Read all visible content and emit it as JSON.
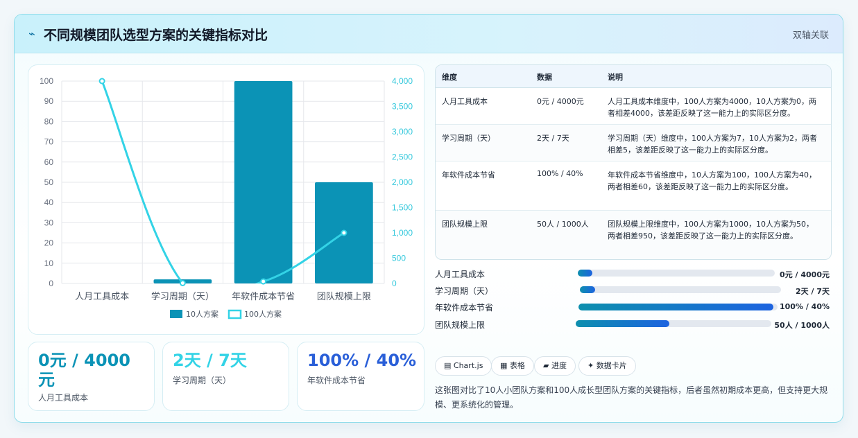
{
  "header": {
    "icon": "sparkline-icon",
    "title": "不同规模团队选型方案的关键指标对比",
    "tag": "双轴关联"
  },
  "chart_data": {
    "type": "bar",
    "categories": [
      "人月工具成本",
      "学习周期（天）",
      "年软件成本节省",
      "团队规模上限"
    ],
    "series": [
      {
        "name": "10人方案",
        "type": "bar",
        "axis": "left",
        "values": [
          0,
          2,
          100,
          50
        ],
        "color": "#0b93b6"
      },
      {
        "name": "100人方案",
        "type": "line",
        "axis": "right",
        "values": [
          4000,
          7,
          40,
          1000
        ],
        "color": "#33d3e6"
      }
    ],
    "y_left": {
      "min": 0,
      "max": 100,
      "ticks": [
        0,
        10,
        20,
        30,
        40,
        50,
        60,
        70,
        80,
        90,
        100
      ]
    },
    "y_right": {
      "min": 0,
      "max": 4000,
      "ticks": [
        "0",
        "500",
        "1,000",
        "1,500",
        "2,000",
        "2,500",
        "3,000",
        "3,500",
        "4,000"
      ]
    },
    "legend": "bottom",
    "grid": true
  },
  "stats": [
    {
      "value": "0元 / 4000元",
      "label": "人月工具成本",
      "color": "#0b93b6"
    },
    {
      "value": "2天 / 7天",
      "label": "学习周期（天）",
      "color": "#33d3e6"
    },
    {
      "value": "100% / 40%",
      "label": "年软件成本节省",
      "color": "#2a5fd8"
    }
  ],
  "table": {
    "headers": [
      "维度",
      "数据",
      "说明"
    ],
    "rows": [
      {
        "dim": "人月工具成本",
        "data": "0元 / 4000元",
        "desc": "人月工具成本维度中，100人方案为4000，10人方案为0，两者相差4000，该差距反映了这一能力上的实际区分度。"
      },
      {
        "dim": "学习周期（天）",
        "data": "2天 / 7天",
        "desc": "学习周期（天）维度中，100人方案为7，10人方案为2，两者相差5，该差距反映了这一能力上的实际区分度。"
      },
      {
        "dim": "年软件成本节省",
        "data": "100% / 40%",
        "desc": "年软件成本节省维度中，10人方案为100，100人方案为40，两者相差60，该差距反映了这一能力上的实际区分度。"
      },
      {
        "dim": "团队规模上限",
        "data": "50人 / 1000人",
        "desc": "团队规模上限维度中，100人方案为1000，10人方案为50，两者相差950，该差距反映了这一能力上的实际区分度。"
      }
    ]
  },
  "progress": [
    {
      "label": "人月工具成本",
      "value": "0元 / 4000元",
      "fill": 0.075
    },
    {
      "label": "学习周期（天）",
      "value": "2天 / 7天",
      "fill": 0.075
    },
    {
      "label": "年软件成本节省",
      "value": "100% / 40%",
      "fill": 0.98
    },
    {
      "label": "团队规模上限",
      "value": "50人 / 1000人",
      "fill": 0.48
    }
  ],
  "chips": [
    {
      "icon": "file-icon",
      "glyph": "▤",
      "label": "Chart.js"
    },
    {
      "icon": "table-icon",
      "glyph": "▦",
      "label": "表格"
    },
    {
      "icon": "progress-icon",
      "glyph": "▰",
      "label": "进度"
    },
    {
      "icon": "sparkle-icon",
      "glyph": "✦",
      "label": "数据卡片"
    }
  ],
  "summary": "这张图对比了10人小团队方案和100人成长型团队方案的关键指标，后者虽然初期成本更高，但支持更大规模、更系统化的管理。"
}
